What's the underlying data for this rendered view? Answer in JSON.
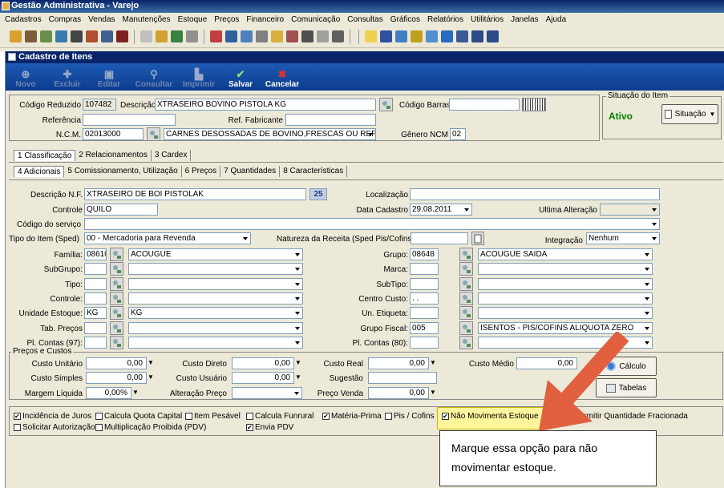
{
  "app": {
    "title": "Gestão Administrativa - Varejo"
  },
  "menu": [
    "Cadastros",
    "Compras",
    "Vendas",
    "Manutenções",
    "Estoque",
    "Preços",
    "Financeiro",
    "Comunicação",
    "Consultas",
    "Gráficos",
    "Relatórios",
    "Utilitários",
    "Janelas",
    "Ajuda"
  ],
  "window": {
    "title": "Cadastro de Itens"
  },
  "toolbar": {
    "novo": "Novo",
    "excluir": "Excluir",
    "editar": "Editar",
    "consultar": "Consultar",
    "imprimir": "Imprimir",
    "salvar": "Salvar",
    "cancelar": "Cancelar"
  },
  "header": {
    "codigo_reduzido_label": "Código Reduzido",
    "codigo_reduzido": "107482",
    "descricao_label": "Descrição",
    "descricao": "XTRASEIRO BOVINO PISTOLA KG",
    "codigo_barras_label": "Código Barras",
    "codigo_barras": "",
    "referencia_label": "Referência",
    "referencia": "",
    "ref_fabricante_label": "Ref. Fabricante",
    "ref_fabricante": "",
    "ncm_label": "N.C.M.",
    "ncm": "02013000",
    "ncm_desc": "CARNES DESOSSADAS DE BOVINO,FRESCAS OU REFF",
    "genero_ncm_label": "Gênero NCM",
    "genero_ncm": "02"
  },
  "situacao": {
    "legend": "Situação do Item",
    "status": "Ativo",
    "button": "Situação",
    "status_color": "#008000"
  },
  "tabs1": [
    "1 Classificação",
    "2 Relacionamentos",
    "3 Cardex"
  ],
  "tabs2": [
    "4 Adicionais",
    "5 Comissionamento, Utilização",
    "6 Preços",
    "7 Quantidades",
    "8 Características"
  ],
  "adicionais": {
    "descricao_nf_label": "Descrição N.F.",
    "descricao_nf": "XTRASEIRO DE BOI PISTOLAK",
    "descricao_nf_count": "25",
    "localizacao_label": "Localização",
    "localizacao": "",
    "controle_label": "Controle",
    "controle": "QUILO",
    "data_cadastro_label": "Data Cadastro",
    "data_cadastro": "29.08.2011",
    "ultima_alteracao_label": "Ultima Alteração",
    "ultima_alteracao": "",
    "codigo_servico_label": "Código do serviço",
    "codigo_servico": "",
    "tipo_item_label": "Tipo do Item (Sped)",
    "tipo_item": "00 - Mercadoria para Revenda",
    "natureza_receita_label": "Natureza da Receita (Sped Pis/Cofins)",
    "natureza_receita": "",
    "integracao_label": "Integração",
    "integracao": "Nenhum"
  },
  "left_rows": [
    {
      "label": "Família:",
      "code": "08610",
      "desc": "ACOUGUE"
    },
    {
      "label": "SubGrupo:",
      "code": "",
      "desc": ""
    },
    {
      "label": "Tipo:",
      "code": "",
      "desc": ""
    },
    {
      "label": "Controle:",
      "code": "",
      "desc": ""
    },
    {
      "label": "Unidade Estoque:",
      "code": "KG",
      "desc": "KG"
    },
    {
      "label": "Tab. Preços",
      "code": "",
      "desc": ""
    },
    {
      "label": "Pl. Contas (97):",
      "code": "",
      "desc": ""
    }
  ],
  "right_rows": [
    {
      "label": "Grupo:",
      "code": "08648",
      "desc": "ACOUGUE SAIDA"
    },
    {
      "label": "Marca:",
      "code": "",
      "desc": ""
    },
    {
      "label": "SubTipo:",
      "code": "",
      "desc": ""
    },
    {
      "label": "Centro Custo:",
      "code": " .  .",
      "desc": ""
    },
    {
      "label": "Un. Etiqueta:",
      "code": "",
      "desc": ""
    },
    {
      "label": "Grupo Fiscal:",
      "code": "005",
      "desc": "ISENTOS - PIS/COFINS ALIQUOTA ZERO"
    },
    {
      "label": "Pl. Contas (80):",
      "code": "",
      "desc": ""
    }
  ],
  "precos": {
    "legend": "Preços e Custos",
    "custo_unitario_label": "Custo Unitário",
    "custo_unitario": "0,00",
    "custo_simples_label": "Custo Simples",
    "custo_simples": "0,00",
    "margem_liquida_label": "Margem Líquida",
    "margem_liquida": "0,00%",
    "custo_direto_label": "Custo Direto",
    "custo_direto": "0,00",
    "custo_usuario_label": "Custo Usuário",
    "custo_usuario": "0,00",
    "alteracao_preco_label": "Alteração Preço",
    "alteracao_preco": "",
    "custo_real_label": "Custo Real",
    "custo_real": "0,00",
    "sugestao_label": "Sugestão",
    "sugestao": "",
    "preco_venda_label": "Preço Venda",
    "preco_venda": "0,00",
    "custo_medio_label": "Custo Médio",
    "custo_medio": "0,00",
    "calculo_button": "Cálculo",
    "tabelas_button": "Tabelas"
  },
  "checkboxes_row1": [
    {
      "label": "Incidência de Juros",
      "checked": true
    },
    {
      "label": "Calcula Quota Capital",
      "checked": false
    },
    {
      "label": "Item Pesável",
      "checked": false
    },
    {
      "label": "Calcula Funrural",
      "checked": false
    },
    {
      "label": "Matéria-Prima",
      "checked": true
    },
    {
      "label": "Pis / Cofins",
      "checked": false
    },
    {
      "label": "Não Movimenta Estoque",
      "checked": true
    },
    {
      "label": "Não Permitir Quantidade Fracionada",
      "checked": false
    }
  ],
  "checkboxes_row2": [
    {
      "label": "Solicitar Autorização",
      "checked": false
    },
    {
      "label": "Multiplicação Proibida (PDV)",
      "checked": false
    },
    {
      "label": "Envia PDV",
      "checked": true
    }
  ],
  "callout": {
    "text": "Marque essa opção para não movimentar estoque.",
    "arrow_color": "#e06040",
    "highlight_color": "#fff59d"
  }
}
